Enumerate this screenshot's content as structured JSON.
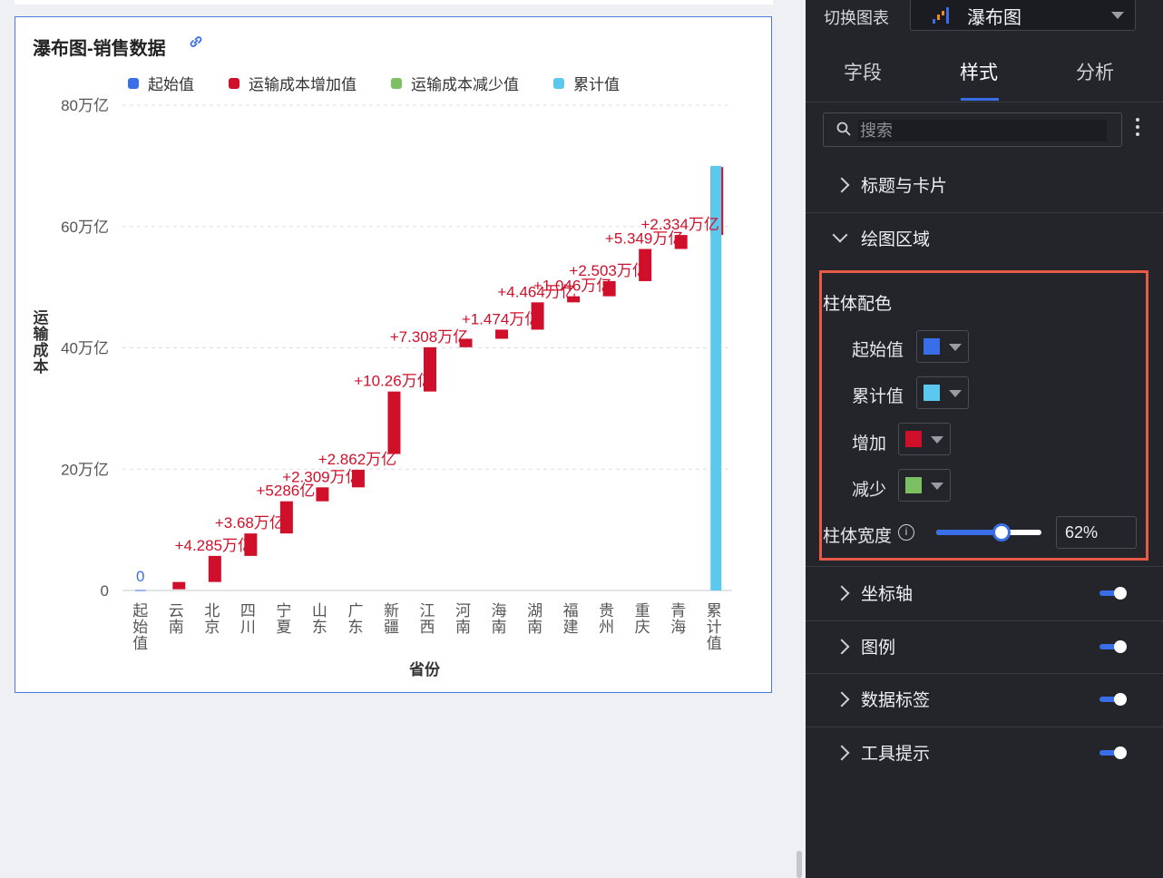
{
  "chart_card": {
    "title": "瀑布图-销售数据",
    "link_icon": "link-icon"
  },
  "legend": [
    {
      "label": "起始值",
      "color": "#3a6ee8"
    },
    {
      "label": "运输成本增加值",
      "color": "#d0102a"
    },
    {
      "label": "运输成本减少值",
      "color": "#7cbf63"
    },
    {
      "label": "累计值",
      "color": "#5bc8ee"
    }
  ],
  "chart_data": {
    "type": "bar",
    "subtype": "waterfall",
    "xlabel": "省份",
    "ylabel": "运输成本",
    "ylim": [
      0,
      80
    ],
    "y_unit": "万亿",
    "y_ticks": [
      "0",
      "20万亿",
      "40万亿",
      "60万亿",
      "80万亿"
    ],
    "grid": true,
    "legend_position": "top",
    "categories": [
      "起始值",
      "云南",
      "北京",
      "四川",
      "宁夏",
      "山东",
      "广东",
      "新疆",
      "江西",
      "河南",
      "海南",
      "湖南",
      "福建",
      "贵州",
      "重庆",
      "青海",
      "累计值"
    ],
    "series": [
      {
        "name": "起始值",
        "values": [
          0
        ],
        "color": "#3a6ee8"
      },
      {
        "name": "运输成本增加值",
        "color": "#d0102a",
        "ranges": [
          [
            0.2,
            1.4
          ],
          [
            1.4,
            5.7
          ],
          [
            5.7,
            9.4
          ],
          [
            9.4,
            14.7
          ],
          [
            14.7,
            17.0
          ],
          [
            17.0,
            19.9
          ],
          [
            22.5,
            32.8
          ],
          [
            32.8,
            40.1
          ],
          [
            40.1,
            41.5
          ],
          [
            41.5,
            43.0
          ],
          [
            43.0,
            47.5
          ],
          [
            47.5,
            48.5
          ],
          [
            48.5,
            51.0
          ],
          [
            51.0,
            56.3
          ],
          [
            56.3,
            58.6
          ],
          [
            58.6,
            69.8
          ]
        ]
      },
      {
        "name": "运输成本减少值",
        "values": [],
        "color": "#7cbf63"
      },
      {
        "name": "累计值",
        "values": [
          70.0
        ],
        "color": "#5bc8ee"
      }
    ],
    "data_labels": [
      "0",
      "+4.285万亿",
      "+3.68万亿",
      "+5286亿",
      "+2.309万亿",
      "+2.862万亿",
      "+10.26万亿",
      "+7.308万亿",
      "+1.474万亿",
      "+4.464万亿",
      "+1.046万亿",
      "+2.503万亿",
      "+5.349万亿",
      "+2.334万亿"
    ]
  },
  "panel": {
    "switch_label": "切换图表",
    "switch_value": "瀑布图",
    "tabs": [
      "字段",
      "样式",
      "分析"
    ],
    "active_tab": "样式",
    "search_placeholder": "搜索",
    "sections": [
      {
        "label": "标题与卡片",
        "expanded": false
      },
      {
        "label": "绘图区域",
        "expanded": true
      },
      {
        "label": "坐标轴",
        "expanded": false,
        "toggle": true
      },
      {
        "label": "图例",
        "expanded": false,
        "toggle": true
      },
      {
        "label": "数据标签",
        "expanded": false,
        "toggle": true
      },
      {
        "label": "工具提示",
        "expanded": false,
        "toggle": true
      }
    ],
    "bar_colors": {
      "title": "柱体配色",
      "start_label": "起始值",
      "start_color": "#3a6ee8",
      "total_label": "累计值",
      "total_color": "#5bc8ee",
      "increase_label": "增加",
      "increase_color": "#d0102a",
      "decrease_label": "减少",
      "decrease_color": "#7cbf63"
    },
    "bar_width": {
      "label": "柱体宽度",
      "value": "62%",
      "fraction": 0.62
    }
  }
}
